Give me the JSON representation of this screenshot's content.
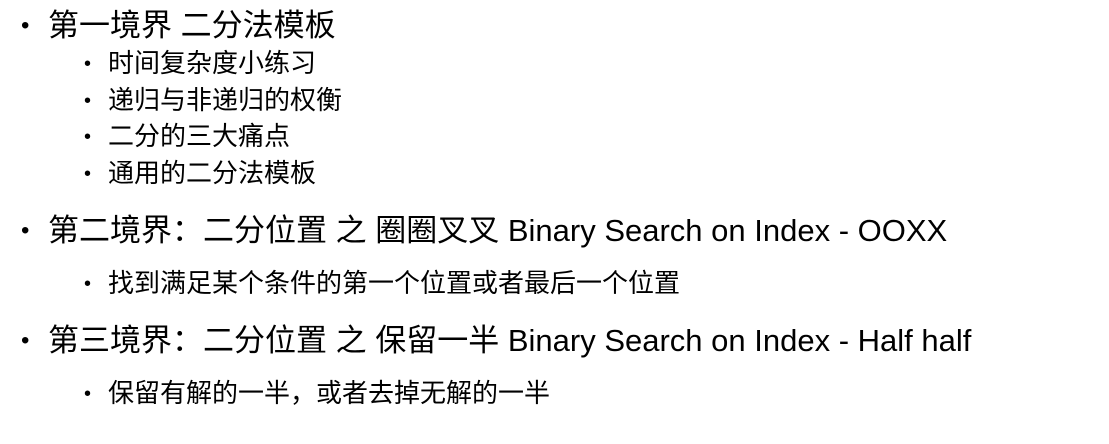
{
  "outline": {
    "bullet_glyph": "•",
    "s1": {
      "title": "第一境界 二分法模板",
      "items": [
        "时间复杂度小练习",
        "递归与非递归的权衡",
        "二分的三大痛点",
        "通用的二分法模板"
      ]
    },
    "s2": {
      "title": "第二境界：二分位置 之 圈圈叉叉 Binary Search on Index - OOXX",
      "items": [
        "找到满足某个条件的第一个位置或者最后一个位置"
      ]
    },
    "s3": {
      "title": "第三境界：二分位置 之 保留一半 Binary Search on Index - Half half",
      "items": [
        "保留有解的一半，或者去掉无解的一半"
      ]
    }
  }
}
